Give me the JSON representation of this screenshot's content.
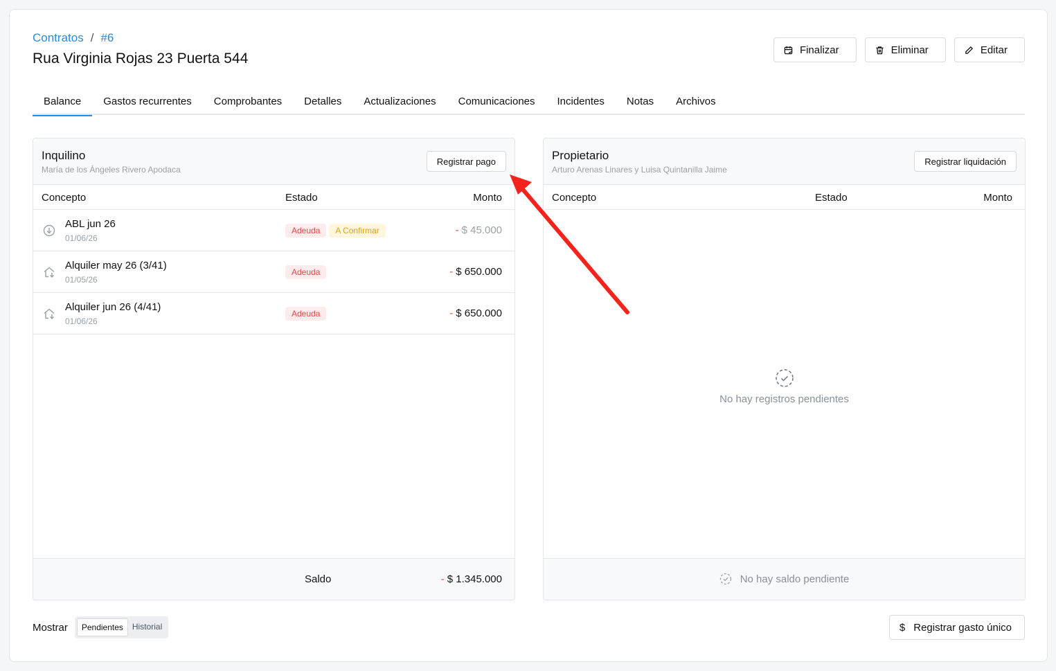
{
  "breadcrumb": {
    "parent": "Contratos",
    "separator": "/",
    "current": "#6"
  },
  "page": {
    "title": "Rua Virginia Rojas 23 Puerta 544"
  },
  "actions": {
    "finalize": "Finalizar",
    "delete": "Eliminar",
    "edit": "Editar"
  },
  "tabs": [
    "Balance",
    "Gastos recurrentes",
    "Comprobantes",
    "Detalles",
    "Actualizaciones",
    "Comunicaciones",
    "Incidentes",
    "Notas",
    "Archivos"
  ],
  "active_tab": "Balance",
  "tenant": {
    "title": "Inquilino",
    "name": "María de los Ángeles Rivero Apodaca",
    "button": "Registrar pago",
    "columns": {
      "concept": "Concepto",
      "status": "Estado",
      "amount": "Monto"
    },
    "rows": [
      {
        "icon": "arrow-down-circle-icon",
        "concept": "ABL jun 26",
        "date": "01/06/26",
        "badges": [
          "Adeuda",
          "A Confirmar"
        ],
        "sign": "-",
        "amount": "$ 45.000",
        "muted": true
      },
      {
        "icon": "house-down-icon",
        "concept": "Alquiler may 26 (3/41)",
        "date": "01/05/26",
        "badges": [
          "Adeuda"
        ],
        "sign": "-",
        "amount": "$ 650.000",
        "muted": false
      },
      {
        "icon": "house-down-icon",
        "concept": "Alquiler jun 26 (4/41)",
        "date": "01/06/26",
        "badges": [
          "Adeuda"
        ],
        "sign": "-",
        "amount": "$ 650.000",
        "muted": false
      }
    ],
    "saldo_label": "Saldo",
    "saldo_sign": "-",
    "saldo_amount": "$ 1.345.000"
  },
  "owner": {
    "title": "Propietario",
    "name": "Arturo Arenas Linares y Luisa Quintanilla Jaime",
    "button": "Registrar liquidación",
    "columns": {
      "concept": "Concepto",
      "status": "Estado",
      "amount": "Monto"
    },
    "empty": "No hay registros pendientes",
    "empty_saldo": "No hay saldo pendiente"
  },
  "filter": {
    "label": "Mostrar",
    "options": [
      "Pendientes",
      "Historial"
    ],
    "selected": "Pendientes"
  },
  "bottom_button": "Registrar gasto único",
  "colors": {
    "accent": "#2b8ad9",
    "danger": "#e04848",
    "warning": "#e0a11a",
    "annotation": "#f5231b"
  }
}
